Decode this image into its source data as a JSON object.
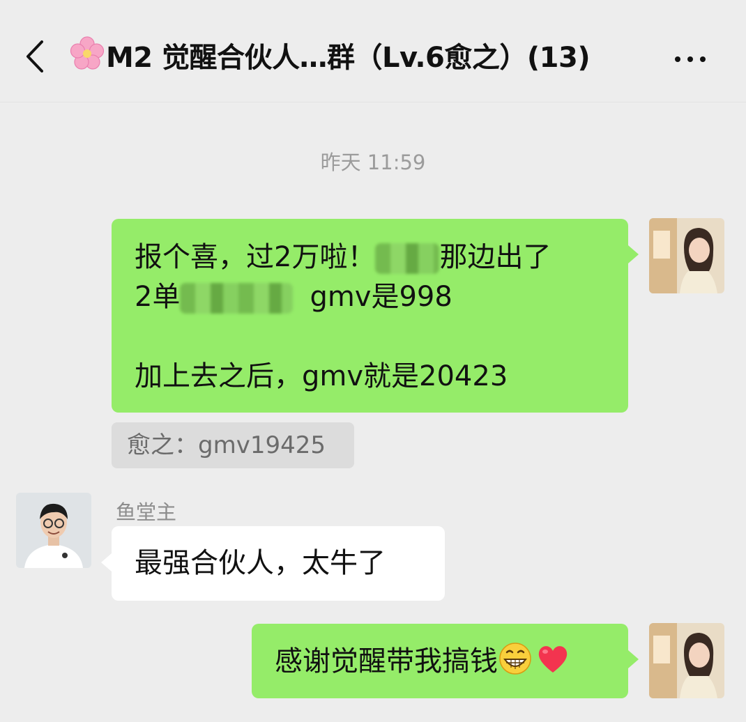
{
  "header": {
    "title": "M2 觉醒合伙人…群（Lv.6愈之）(13)",
    "back_icon": "chevron-left-icon",
    "more_icon": "ellipsis-icon",
    "title_icon": "cherry-blossom-icon"
  },
  "timestamp": "昨天 11:59",
  "messages": [
    {
      "side": "right",
      "line1_a": "报个喜，过2万啦！",
      "line1_b": "那边出了",
      "line2_a": "2单",
      "line2_b": "gmv是998",
      "line4": "加上去之后，gmv就是20423",
      "quote": "愈之：gmv19425"
    },
    {
      "side": "left",
      "sender": "鱼堂主",
      "text": "最强合伙人，太牛了"
    },
    {
      "side": "right",
      "text": "感谢觉醒带我搞钱",
      "emojis": [
        "grinning-face-icon",
        "heart-icon"
      ]
    }
  ],
  "colors": {
    "background": "#ededed",
    "bubble_self": "#95ec69",
    "bubble_other": "#ffffff",
    "quote_bg": "#dcdcdc"
  }
}
